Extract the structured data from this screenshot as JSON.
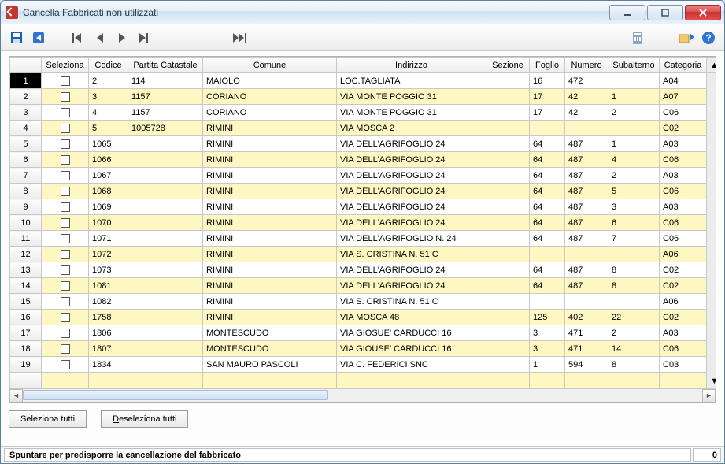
{
  "window": {
    "title": "Cancella Fabbricati non utilizzati"
  },
  "toolbar": {
    "save": "save",
    "back": "back",
    "first": "first",
    "prev": "prev",
    "next": "next",
    "last": "last",
    "fast": "fast-forward",
    "calc": "calculator",
    "export": "export",
    "help": "help"
  },
  "columns": {
    "seleziona": "Seleziona",
    "codice": "Codice",
    "partita": "Partita Catastale",
    "comune": "Comune",
    "indirizzo": "Indirizzo",
    "sezione": "Sezione",
    "foglio": "Foglio",
    "numero": "Numero",
    "subalterno": "Subalterno",
    "categoria": "Categoria"
  },
  "rows": [
    {
      "n": "1",
      "cod": "2",
      "part": "114",
      "com": "MAIOLO",
      "ind": "LOC.TAGLIATA",
      "sez": "",
      "fog": "16",
      "num": "472",
      "sub": "",
      "cat": "A04"
    },
    {
      "n": "2",
      "cod": "3",
      "part": "1157",
      "com": "CORIANO",
      "ind": "VIA MONTE POGGIO 31",
      "sez": "",
      "fog": "17",
      "num": "42",
      "sub": "1",
      "cat": "A07"
    },
    {
      "n": "3",
      "cod": "4",
      "part": "1157",
      "com": "CORIANO",
      "ind": "VIA MONTE POGGIO 31",
      "sez": "",
      "fog": "17",
      "num": "42",
      "sub": "2",
      "cat": "C06"
    },
    {
      "n": "4",
      "cod": "5",
      "part": "1005728",
      "com": "RIMINI",
      "ind": "VIA MOSCA 2",
      "sez": "",
      "fog": "",
      "num": "",
      "sub": "",
      "cat": "C02"
    },
    {
      "n": "5",
      "cod": "1065",
      "part": "",
      "com": "RIMINI",
      "ind": "VIA DELL'AGRIFOGLIO 24",
      "sez": "",
      "fog": "64",
      "num": "487",
      "sub": "1",
      "cat": "A03"
    },
    {
      "n": "6",
      "cod": "1066",
      "part": "",
      "com": "RIMINI",
      "ind": "VIA DELL'AGRIFOGLIO 24",
      "sez": "",
      "fog": "64",
      "num": "487",
      "sub": "4",
      "cat": "C06"
    },
    {
      "n": "7",
      "cod": "1067",
      "part": "",
      "com": "RIMINI",
      "ind": "VIA DELL'AGRIFOGLIO 24",
      "sez": "",
      "fog": "64",
      "num": "487",
      "sub": "2",
      "cat": "A03"
    },
    {
      "n": "8",
      "cod": "1068",
      "part": "",
      "com": "RIMINI",
      "ind": "VIA DELL'AGRIFOGLIO 24",
      "sez": "",
      "fog": "64",
      "num": "487",
      "sub": "5",
      "cat": "C06"
    },
    {
      "n": "9",
      "cod": "1069",
      "part": "",
      "com": "RIMINI",
      "ind": "VIA DELL'AGRIFOGLIO 24",
      "sez": "",
      "fog": "64",
      "num": "487",
      "sub": "3",
      "cat": "A03"
    },
    {
      "n": "10",
      "cod": "1070",
      "part": "",
      "com": "RIMINI",
      "ind": "VIA DELL'AGRIFOGLIO 24",
      "sez": "",
      "fog": "64",
      "num": "487",
      "sub": "6",
      "cat": "C06"
    },
    {
      "n": "11",
      "cod": "1071",
      "part": "",
      "com": "RIMINI",
      "ind": "VIA DELL'AGRIFOGLIO N. 24",
      "sez": "",
      "fog": "64",
      "num": "487",
      "sub": "7",
      "cat": "C06"
    },
    {
      "n": "12",
      "cod": "1072",
      "part": "",
      "com": "RIMINI",
      "ind": "VIA S. CRISTINA N. 51 C",
      "sez": "",
      "fog": "",
      "num": "",
      "sub": "",
      "cat": "A06"
    },
    {
      "n": "13",
      "cod": "1073",
      "part": "",
      "com": "RIMINI",
      "ind": "VIA DELL'AGRIFOGLIO 24",
      "sez": "",
      "fog": "64",
      "num": "487",
      "sub": "8",
      "cat": "C02"
    },
    {
      "n": "14",
      "cod": "1081",
      "part": "",
      "com": "RIMINI",
      "ind": "VIA DELL'AGRIFOGLIO 24",
      "sez": "",
      "fog": "64",
      "num": "487",
      "sub": "8",
      "cat": "C02"
    },
    {
      "n": "15",
      "cod": "1082",
      "part": "",
      "com": "RIMINI",
      "ind": "VIA S. CRISTINA N. 51 C",
      "sez": "",
      "fog": "",
      "num": "",
      "sub": "",
      "cat": "A06"
    },
    {
      "n": "16",
      "cod": "1758",
      "part": "",
      "com": "RIMINI",
      "ind": "VIA MOSCA  48",
      "sez": "",
      "fog": "125",
      "num": "402",
      "sub": "22",
      "cat": "C02"
    },
    {
      "n": "17",
      "cod": "1806",
      "part": "",
      "com": "MONTESCUDO",
      "ind": "VIA GIOSUE' CARDUCCI 16",
      "sez": "",
      "fog": "3",
      "num": "471",
      "sub": "2",
      "cat": "A03"
    },
    {
      "n": "18",
      "cod": "1807",
      "part": "",
      "com": "MONTESCUDO",
      "ind": "VIA GIOUSE' CARDUCCI 16",
      "sez": "",
      "fog": "3",
      "num": "471",
      "sub": "14",
      "cat": "C06"
    },
    {
      "n": "19",
      "cod": "1834",
      "part": "",
      "com": "SAN MAURO PASCOLI",
      "ind": "VIA C. FEDERICI SNC",
      "sez": "",
      "fog": "1",
      "num": "594",
      "sub": "8",
      "cat": "C03"
    }
  ],
  "buttons": {
    "select_all": "Seleziona tutti",
    "deselect_all": "Deseleziona tutti",
    "deselect_all_u": "D"
  },
  "status": {
    "msg": "Spuntare per predisporre la cancellazione del fabbricato",
    "count": "0"
  }
}
